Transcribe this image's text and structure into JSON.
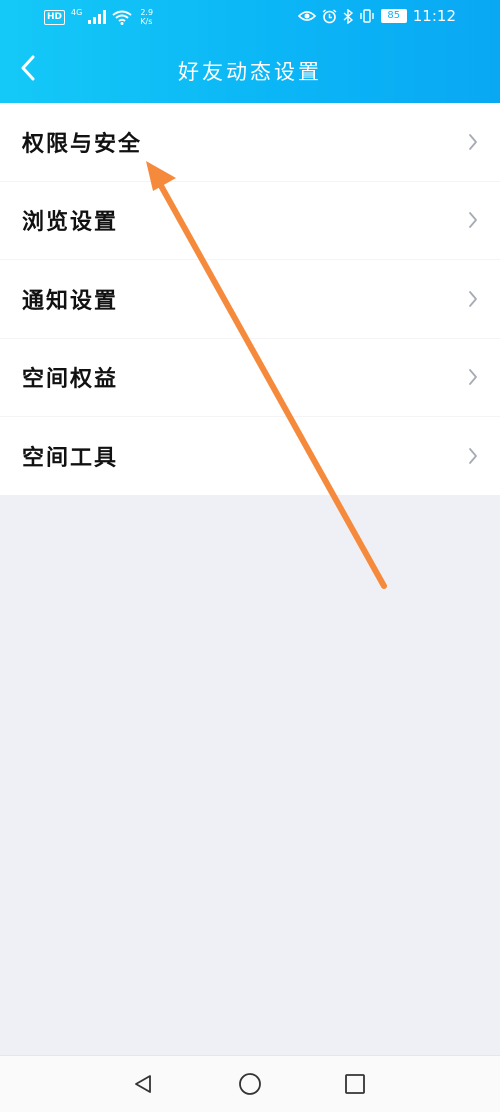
{
  "status_bar": {
    "hd": "HD",
    "signal_type": "4G",
    "net_speed_value": "2.9",
    "net_speed_unit": "K/s",
    "battery": "85",
    "time": "11:12"
  },
  "header": {
    "title": "好友动态设置",
    "back_icon": "chevron-left-icon"
  },
  "menu": {
    "items": [
      {
        "label": "权限与安全"
      },
      {
        "label": "浏览设置"
      },
      {
        "label": "通知设置"
      },
      {
        "label": "空间权益"
      },
      {
        "label": "空间工具"
      }
    ]
  },
  "annotation": {
    "arrow_color": "#f58a3c"
  },
  "colors": {
    "header_start": "#14c9f7",
    "header_end": "#0aa8f3",
    "page_bg": "#eff0f5"
  }
}
